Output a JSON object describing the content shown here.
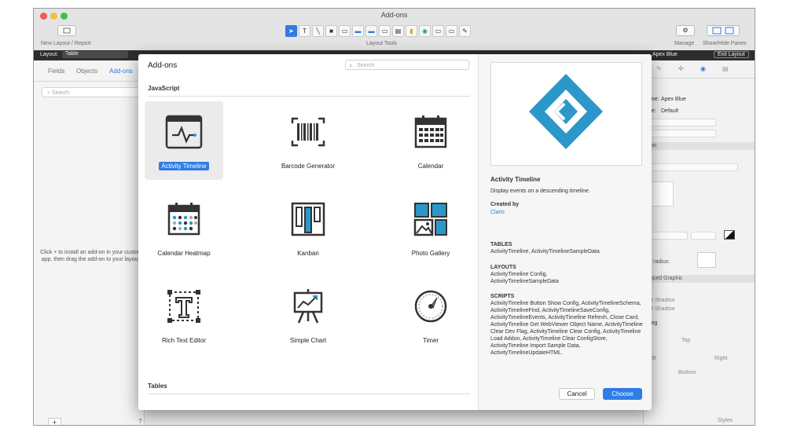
{
  "window": {
    "title": "Add-ons"
  },
  "toolbar": {
    "left_caption": "New Layout / Report",
    "center_caption": "Layout Tools",
    "manage_label": "Manage",
    "panes_label": "Show/Hide Panes"
  },
  "layoutbar": {
    "layout_label": "Layout:",
    "layout_value": "Table",
    "theme_value": "Apex Blue",
    "exit_label": "Exit Layout"
  },
  "left_pane": {
    "tabs": [
      "Fields",
      "Objects",
      "Add-ons"
    ],
    "search_placeholder": "Search",
    "help_text": "Click + to install an add-on in your custom app, then drag the add-on to your layout.",
    "add_label": "+",
    "help_label": "?"
  },
  "right_pane": {
    "name_label": "ame:",
    "name_value": "Apex Blue",
    "style_label": "me:",
    "style_value": "Default",
    "graphic_section": "phic",
    "advanced_section": "anced Graphic",
    "radius_label": "er radius:",
    "shadow1": "ter Shadow",
    "shadow2": "ter Shadow",
    "padding_label": "ding",
    "top_label": "Top",
    "left_label": "Left",
    "right_label": "Right",
    "bottom_label": "Bottom",
    "styles_label": "Styles"
  },
  "dialog": {
    "title": "Add-ons",
    "search_placeholder": "Search",
    "section_js": "JavaScript",
    "section_tables": "Tables",
    "tiles": [
      {
        "label": "Activity Timeline",
        "icon": "activity-timeline-icon",
        "selected": true
      },
      {
        "label": "Barcode Generator",
        "icon": "barcode-icon",
        "selected": false
      },
      {
        "label": "Calendar",
        "icon": "calendar-icon",
        "selected": false
      },
      {
        "label": "Calendar Heatmap",
        "icon": "calendar-heatmap-icon",
        "selected": false
      },
      {
        "label": "Kanban",
        "icon": "kanban-icon",
        "selected": false
      },
      {
        "label": "Photo Gallery",
        "icon": "photo-gallery-icon",
        "selected": false
      },
      {
        "label": "Rich Text Editor",
        "icon": "rich-text-icon",
        "selected": false
      },
      {
        "label": "Simple Chart",
        "icon": "simple-chart-icon",
        "selected": false
      },
      {
        "label": "Timer",
        "icon": "timer-icon",
        "selected": false
      }
    ],
    "detail": {
      "name": "Activity Timeline",
      "description": "Display events on a descending timeline.",
      "created_by_label": "Created by",
      "created_by_value": "Claris",
      "tables_label": "TABLES",
      "tables_value": "ActivityTimeline, ActivityTimelineSampleData",
      "layouts_label": "LAYOUTS",
      "layouts_value": "ActivityTimeline Config, ActivityTimelineSampleData",
      "scripts_label": "SCRIPTS",
      "scripts_value": "ActivityTimeline Button Show Config, ActivityTimelineSchema, ActivityTimelineFind, ActivityTimelineSaveConfig, ActivityTimelineEvents, ActivityTimeline Refresh, Close Card, ActivityTimeline Get WebViewer Object Name, ActivityTimeline Clear Dev Flag, ActivityTimeline Clear Config, ActivityTimeline Load Addon, ActivityTimeline Clear ConfigStore, ActivityTimeline Import Sample Data, ActivityTimelineUpdateHTML."
    },
    "cancel_label": "Cancel",
    "choose_label": "Choose"
  },
  "colors": {
    "accent": "#2f7ce6",
    "logo": "#2b98c9"
  }
}
